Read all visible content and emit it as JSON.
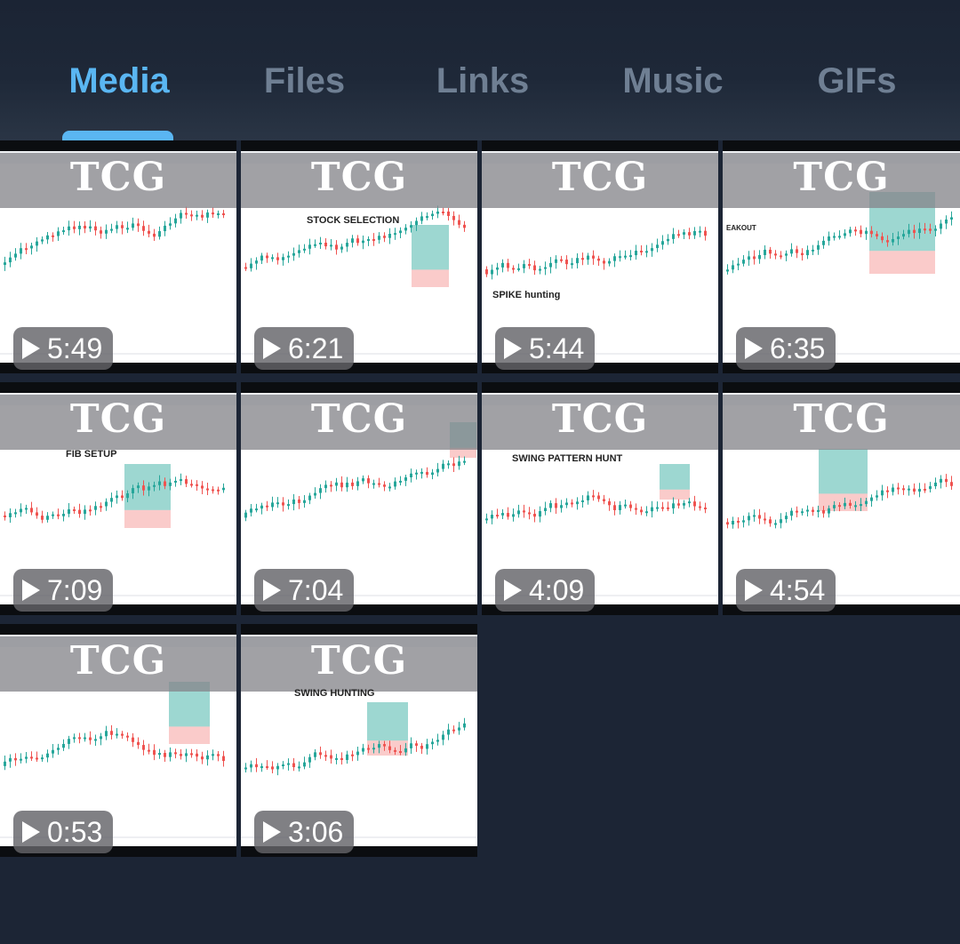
{
  "tabs": [
    {
      "label": "Media",
      "active": true
    },
    {
      "label": "Files",
      "active": false
    },
    {
      "label": "Links",
      "active": false
    },
    {
      "label": "Music",
      "active": false
    },
    {
      "label": "GIFs",
      "active": false
    }
  ],
  "media": [
    {
      "watermark": "TCG",
      "caption": "",
      "duration": "5:49"
    },
    {
      "watermark": "TCG",
      "caption": "STOCK SELECTION",
      "duration": "6:21"
    },
    {
      "watermark": "TCG",
      "caption": "SPIKE hunting",
      "duration": "5:44"
    },
    {
      "watermark": "TCG",
      "caption": "EAKOUT",
      "duration": "6:35"
    },
    {
      "watermark": "TCG",
      "caption": "FIB SETUP",
      "duration": "7:09"
    },
    {
      "watermark": "TCG",
      "caption": "",
      "duration": "7:04"
    },
    {
      "watermark": "TCG",
      "caption": "SWING PATTERN HUNT",
      "duration": "4:09"
    },
    {
      "watermark": "TCG",
      "caption": "",
      "duration": "4:54"
    },
    {
      "watermark": "TCG",
      "caption": "",
      "duration": "0:53"
    },
    {
      "watermark": "TCG",
      "caption": "SWING HUNTING",
      "duration": "3:06"
    }
  ],
  "colors": {
    "background": "#1c2535",
    "tab_active": "#5ab6f2",
    "tab_inactive": "#6f7f93",
    "candle_up": "#26a69a",
    "candle_down": "#ef5350"
  },
  "icons": {
    "play": "play-triangle-icon"
  }
}
